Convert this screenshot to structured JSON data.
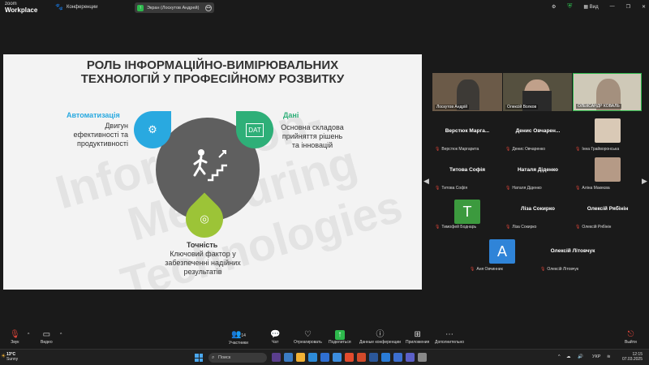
{
  "topbar": {
    "logo_line1": "zoom",
    "logo_line2": "Workplace",
    "conference_label": "Конференции",
    "share_label": "Экран (Лоскутов Андрей)",
    "view_label": "Вид"
  },
  "slide": {
    "title_line1": "РОЛЬ ІНФОРМАЦІЙНО-ВИМІРЮВАЛЬНИХ",
    "title_line2": "ТЕХНОЛОГІЙ У ПРОФЕСІЙНОМУ РОЗВИТКУ",
    "watermark_line1": "Information-",
    "watermark_line2": "Measuring",
    "watermark_line3": "Technologies",
    "automation": {
      "heading": "Автоматизація",
      "line1": "Двигун",
      "line2": "ефективності та",
      "line3": "продуктивності",
      "color": "#29a9e0"
    },
    "data": {
      "heading": "Дані",
      "line1": "Основна складова",
      "line2": "прийняття рішень",
      "line3": "та інновацій",
      "color": "#2eaf78",
      "icon_text": "DAT"
    },
    "accuracy": {
      "heading": "Точність",
      "line1": "Ключовий фактор у",
      "line2": "забезпеченні надійних",
      "line3": "результатів",
      "color": "#9cc437"
    }
  },
  "participants": {
    "videos": [
      {
        "name": "Лоскутов Андрій"
      },
      {
        "name": "Олексій Волков"
      },
      {
        "name": "ОЛЕКСАНДР КОВАЛЬ"
      }
    ],
    "tiles": [
      {
        "big": "Верстюк Маргa...",
        "small": "Верстюк Маргарита"
      },
      {
        "big": "Денис Овчарен...",
        "small": "Денис Овчаренко"
      },
      {
        "big": "",
        "small": "Інна Грайворонська"
      },
      {
        "big": "Титова Софія",
        "small": "Титова Софія"
      },
      {
        "big": "Наталя Діденко",
        "small": "Наталя Діденко"
      },
      {
        "big": "",
        "small": "Аліна Макеєва"
      },
      {
        "big": "",
        "small": "Тимофей Боднарь",
        "letter": "T"
      },
      {
        "big": "Ліза Сокирко",
        "small": "Ліза Сокирко"
      },
      {
        "big": "Олексій Рябінін",
        "small": "Олексій Рябінін"
      },
      {
        "big": "",
        "small": "Аня Овчинник",
        "letter": "A"
      },
      {
        "big": "Олексій Літовчук",
        "small": "Олексій Літовчук"
      }
    ]
  },
  "toolbar": {
    "audio": "Звук",
    "video": "Видео",
    "participants": "Участники",
    "participants_count": "14",
    "chat": "Чат",
    "react": "Отреагировать",
    "share": "Поделиться",
    "conf_data": "Данные конференции",
    "apps": "Приложения",
    "more": "Дополнительно",
    "leave": "Выйти"
  },
  "taskbar": {
    "temp": "13°C",
    "weather": "Sunny",
    "search": "Поиск",
    "lang": "УКР",
    "time": "12:15",
    "date": "07.03.2025"
  }
}
